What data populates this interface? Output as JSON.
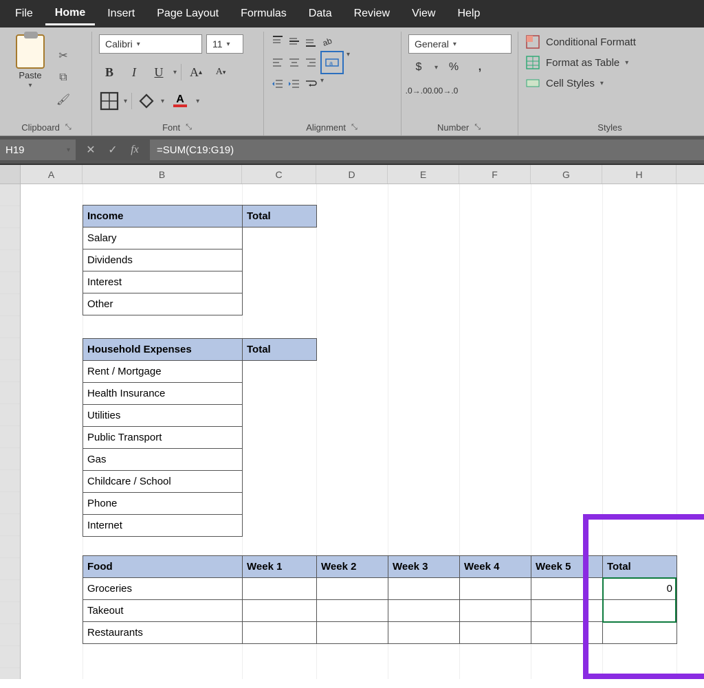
{
  "menu": {
    "items": [
      "File",
      "Home",
      "Insert",
      "Page Layout",
      "Formulas",
      "Data",
      "Review",
      "View",
      "Help"
    ],
    "active": "Home"
  },
  "ribbon": {
    "clipboard": {
      "paste": "Paste",
      "label": "Clipboard"
    },
    "font": {
      "name": "Calibri",
      "size": "11",
      "label": "Font"
    },
    "alignment": {
      "label": "Alignment"
    },
    "number": {
      "format": "General",
      "label": "Number"
    },
    "styles": {
      "cond": "Conditional Formatt",
      "table": "Format as Table",
      "cell": "Cell Styles",
      "label": "Styles"
    }
  },
  "formula_bar": {
    "name_box": "H19",
    "formula": "=SUM(C19:G19)"
  },
  "columns": [
    "A",
    "B",
    "C",
    "D",
    "E",
    "F",
    "G",
    "H"
  ],
  "tables": {
    "income": {
      "header": [
        "Income",
        "Total"
      ],
      "rows": [
        "Salary",
        "Dividends",
        "Interest",
        "Other"
      ]
    },
    "household": {
      "header": [
        "Household Expenses",
        "Total"
      ],
      "rows": [
        "Rent / Mortgage",
        "Health Insurance",
        "Utilities",
        "Public Transport",
        "Gas",
        "Childcare / School",
        "Phone",
        "Internet"
      ]
    },
    "food": {
      "header": [
        "Food",
        "Week 1",
        "Week 2",
        "Week 3",
        "Week 4",
        "Week 5",
        "Total"
      ],
      "rows": [
        {
          "label": "Groceries",
          "total": "0"
        },
        {
          "label": "Takeout",
          "total": ""
        },
        {
          "label": "Restaurants",
          "total": ""
        }
      ]
    }
  }
}
